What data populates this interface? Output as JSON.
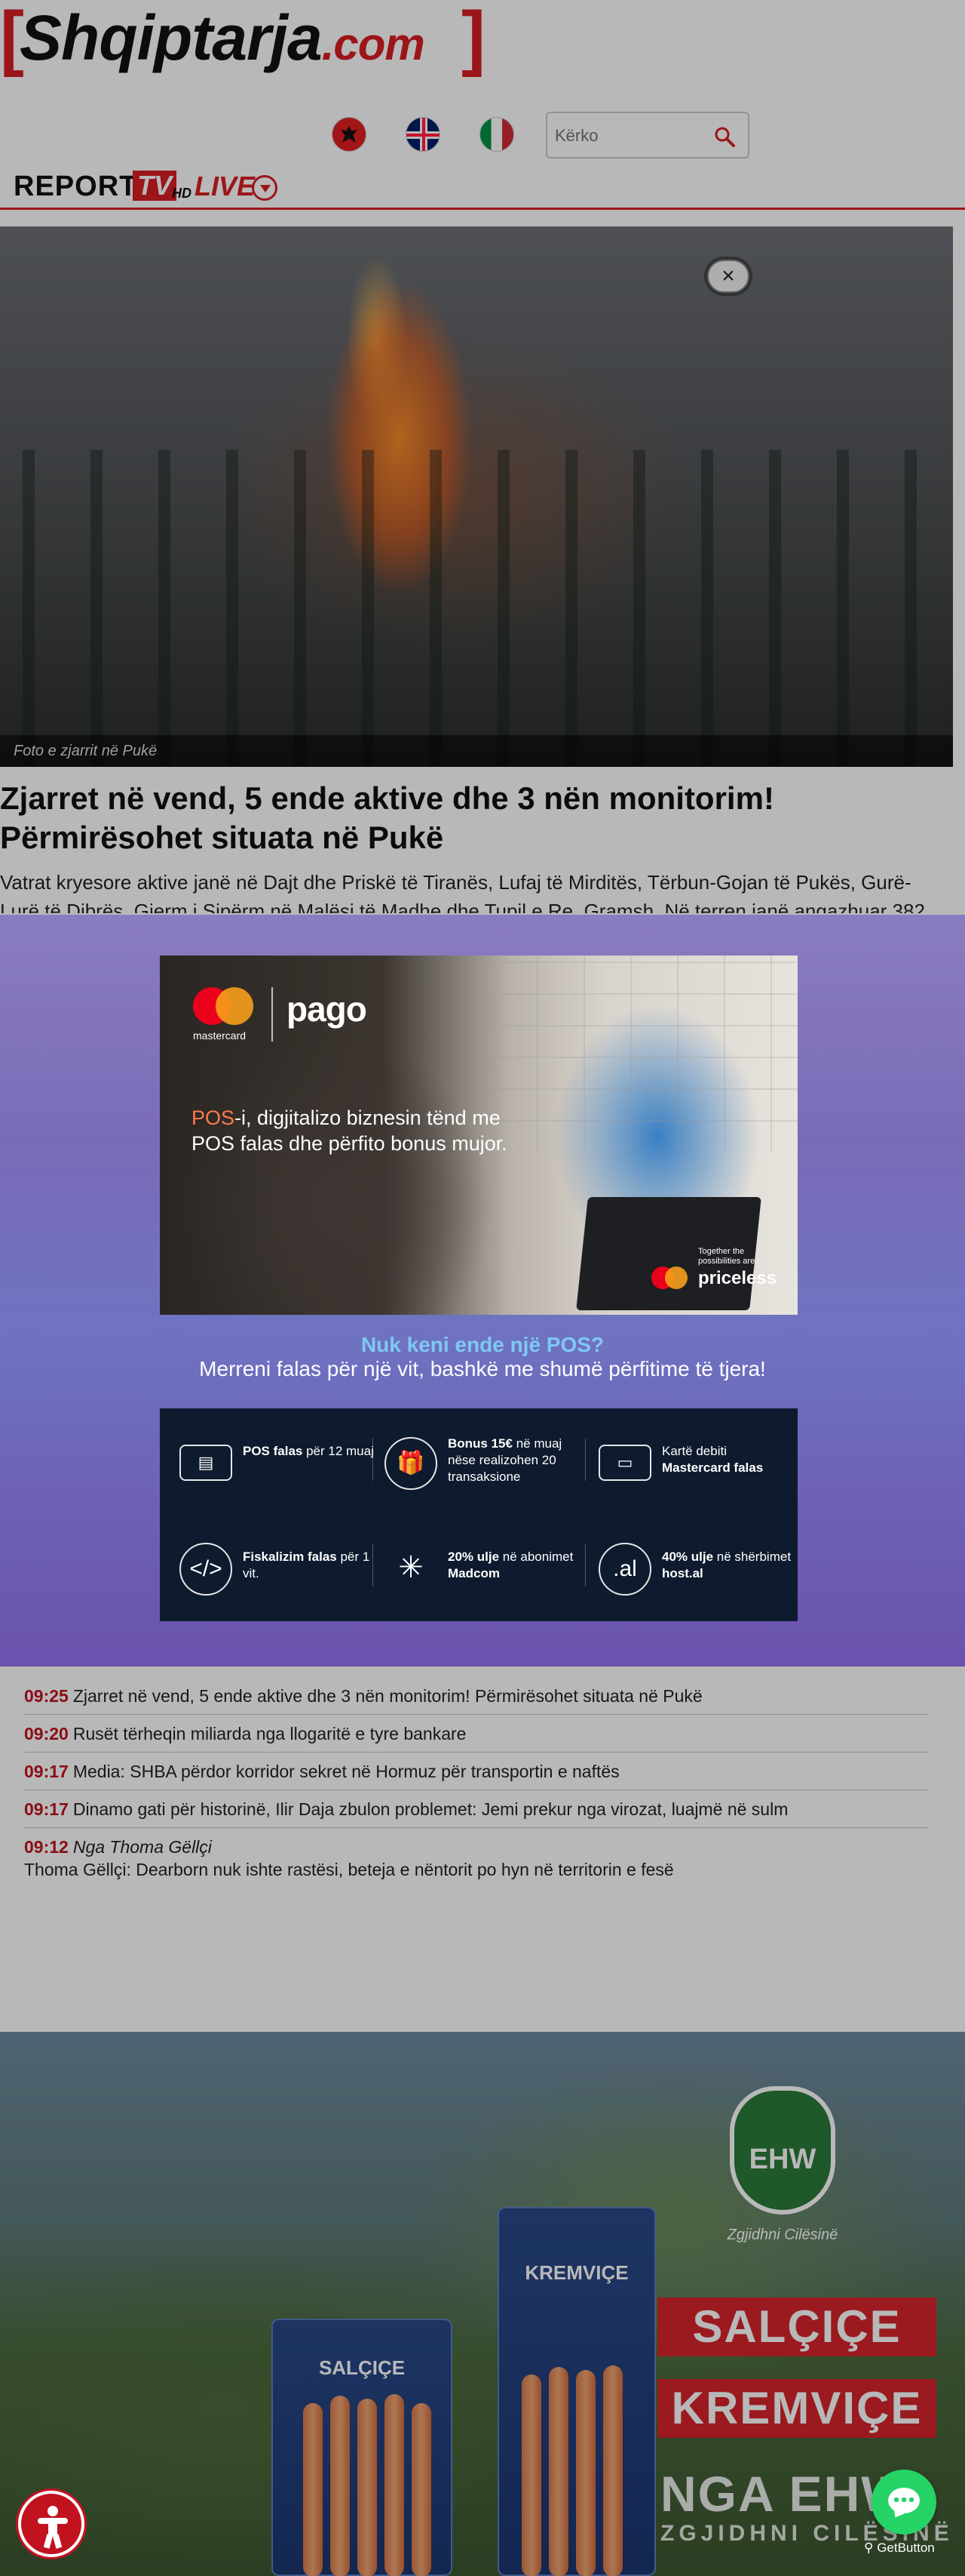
{
  "header": {
    "logo_left_bracket": "[",
    "logo_name": "Shqiptarja",
    "logo_tld": ".com",
    "logo_right_bracket": "]",
    "languages": [
      "Albanian flag",
      "English flag",
      "Italian flag"
    ],
    "search": {
      "placeholder": "Kërko",
      "icon": "search-icon"
    },
    "report_bar": {
      "report": "REPORT",
      "tv": "TV",
      "hd": "HD",
      "live": "LIVE"
    }
  },
  "hero": {
    "caption": "Foto e zjarrit në Pukë",
    "close_label": "×"
  },
  "article": {
    "title": "Zjarret në vend, 5 ende aktive dhe 3 nën monitorim! Përmirësohet situata në Pukë",
    "lead": "Vatrat kryesore aktive janë në Dajt dhe Priskë të Tiranës, Lufaj të Mirditës, Tërbun-Gojan të Pukës, Gurë-Lurë të Dibrës, Gjerm i Sipërm në Malësi të Madhe dhe Tupil e Re, Gramsh. Në terren janë angazhuar 382"
  },
  "promo": {
    "brand_mc": "mastercard",
    "brand_pago": "pago",
    "headline_pos": "POS",
    "headline_rest": "-i, digjitalizo biznesin tënd me POS falas dhe përfito bonus mujor.",
    "priceless_small": "Together the possibilities are",
    "priceless_word": "priceless",
    "question": "Nuk keni ende një POS?",
    "subtitle": "Merreni falas për një vit, bashkë me shumë përfitime të tjera!",
    "benefits": [
      {
        "icon": "card-reader-icon",
        "bold": "POS falas",
        "text": " për 12 muaj"
      },
      {
        "icon": "gift-icon",
        "bold": "Bonus 15€",
        "text": " në muaj nëse realizohen 20 transaksione"
      },
      {
        "icon": "debit-card-icon",
        "pre": "Kartë debiti ",
        "bold": "Mastercard falas",
        "text": ""
      },
      {
        "icon": "code-icon",
        "bold": "Fiskalizim falas",
        "text": " për 1 vit."
      },
      {
        "icon": "madcom-icon",
        "bold": "20% ulje",
        "text": " në abonimet ",
        "bold2": "Madcom"
      },
      {
        "icon": "hostal-icon",
        "bold": "40% ulje",
        "text": " në shërbimet ",
        "bold2": "host.al"
      }
    ]
  },
  "news": [
    {
      "time": "09:25",
      "text": "Zjarret në vend, 5 ende aktive dhe 3 nën monitorim! Përmirësohet situata në Pukë"
    },
    {
      "time": "09:20",
      "text": "Rusët tërheqin miliarda nga llogaritë e tyre bankare"
    },
    {
      "time": "09:17",
      "text": "Media: SHBA përdor korridor sekret në Hormuz për transportin e naftës"
    },
    {
      "time": "09:17",
      "text": "Dinamo gati për historinë, Ilir Daja zbulon problemet: Jemi prekur nga virozat, luajmë në sulm"
    },
    {
      "time": "09:12",
      "author": "Nga Thoma Gëllçi",
      "text": "Thoma Gëllçi: Dearborn nuk ishte rastësi, beteja e nëntorit po hyn në territorin e fesë"
    }
  ],
  "bottom_ad": {
    "badge": "EHW",
    "tagline": "Zgjidhni Cilësinë",
    "banner1": "SALÇIÇE",
    "banner2": "KREMVIÇE",
    "big": "NGA EHW",
    "big2": "ZGJIDHNI CILËSINË",
    "pack1_label": "SALÇIÇE",
    "pack2_label": "KREMVIÇE"
  },
  "floating": {
    "getbutton": "GetButton"
  },
  "colors": {
    "brand_red": "#d81e23",
    "time_red": "#c1121f",
    "promo_purple": "#7a6bb8",
    "benefits_bg": "#0e1b2e",
    "chat_green": "#25d366"
  }
}
